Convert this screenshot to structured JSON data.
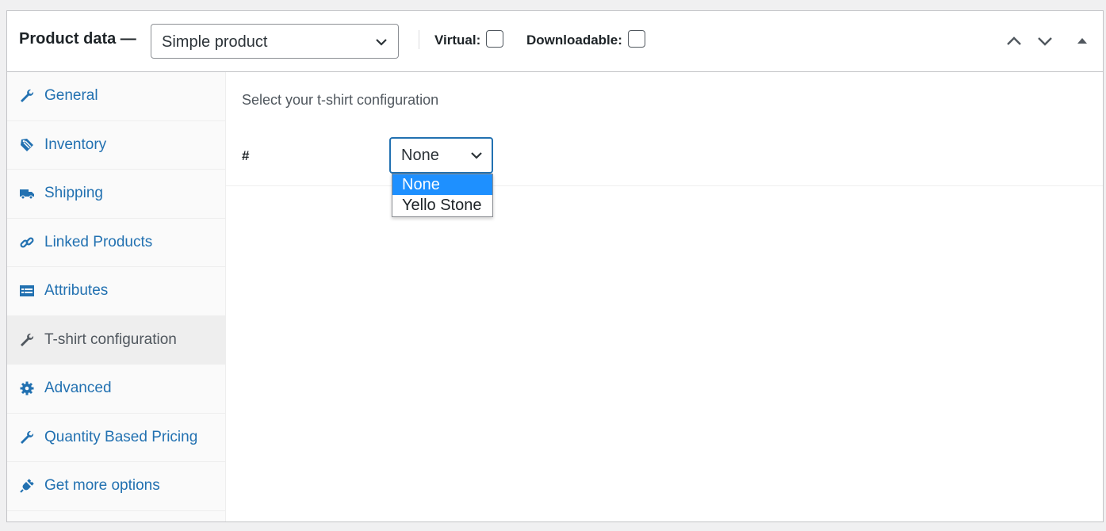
{
  "header": {
    "title": "Product data —",
    "product_type": "Simple product",
    "virtual_label": "Virtual:",
    "downloadable_label": "Downloadable:",
    "icons": [
      "chevron-up-icon",
      "chevron-down-icon",
      "collapse-arrow-icon"
    ]
  },
  "sidebar": {
    "items": [
      {
        "label": "General",
        "icon": "wrench-icon",
        "active": false
      },
      {
        "label": "Inventory",
        "icon": "tag-icon",
        "active": false
      },
      {
        "label": "Shipping",
        "icon": "truck-icon",
        "active": false
      },
      {
        "label": "Linked Products",
        "icon": "link-icon",
        "active": false
      },
      {
        "label": "Attributes",
        "icon": "list-view-icon",
        "active": false
      },
      {
        "label": "T-shirt configuration",
        "icon": "wrench-icon",
        "active": true
      },
      {
        "label": "Advanced",
        "icon": "gear-icon",
        "active": false
      },
      {
        "label": "Quantity Based Pricing",
        "icon": "wrench-icon",
        "active": false
      },
      {
        "label": "Get more options",
        "icon": "plugin-icon",
        "active": false
      }
    ]
  },
  "main": {
    "intro": "Select your t-shirt configuration",
    "field_label": "#",
    "select_value": "None",
    "options": [
      "None",
      "Yello Stone"
    ]
  },
  "colors": {
    "link": "#2271b1",
    "highlight": "#1e90ff",
    "active_tab_bg": "#eeeeee"
  }
}
